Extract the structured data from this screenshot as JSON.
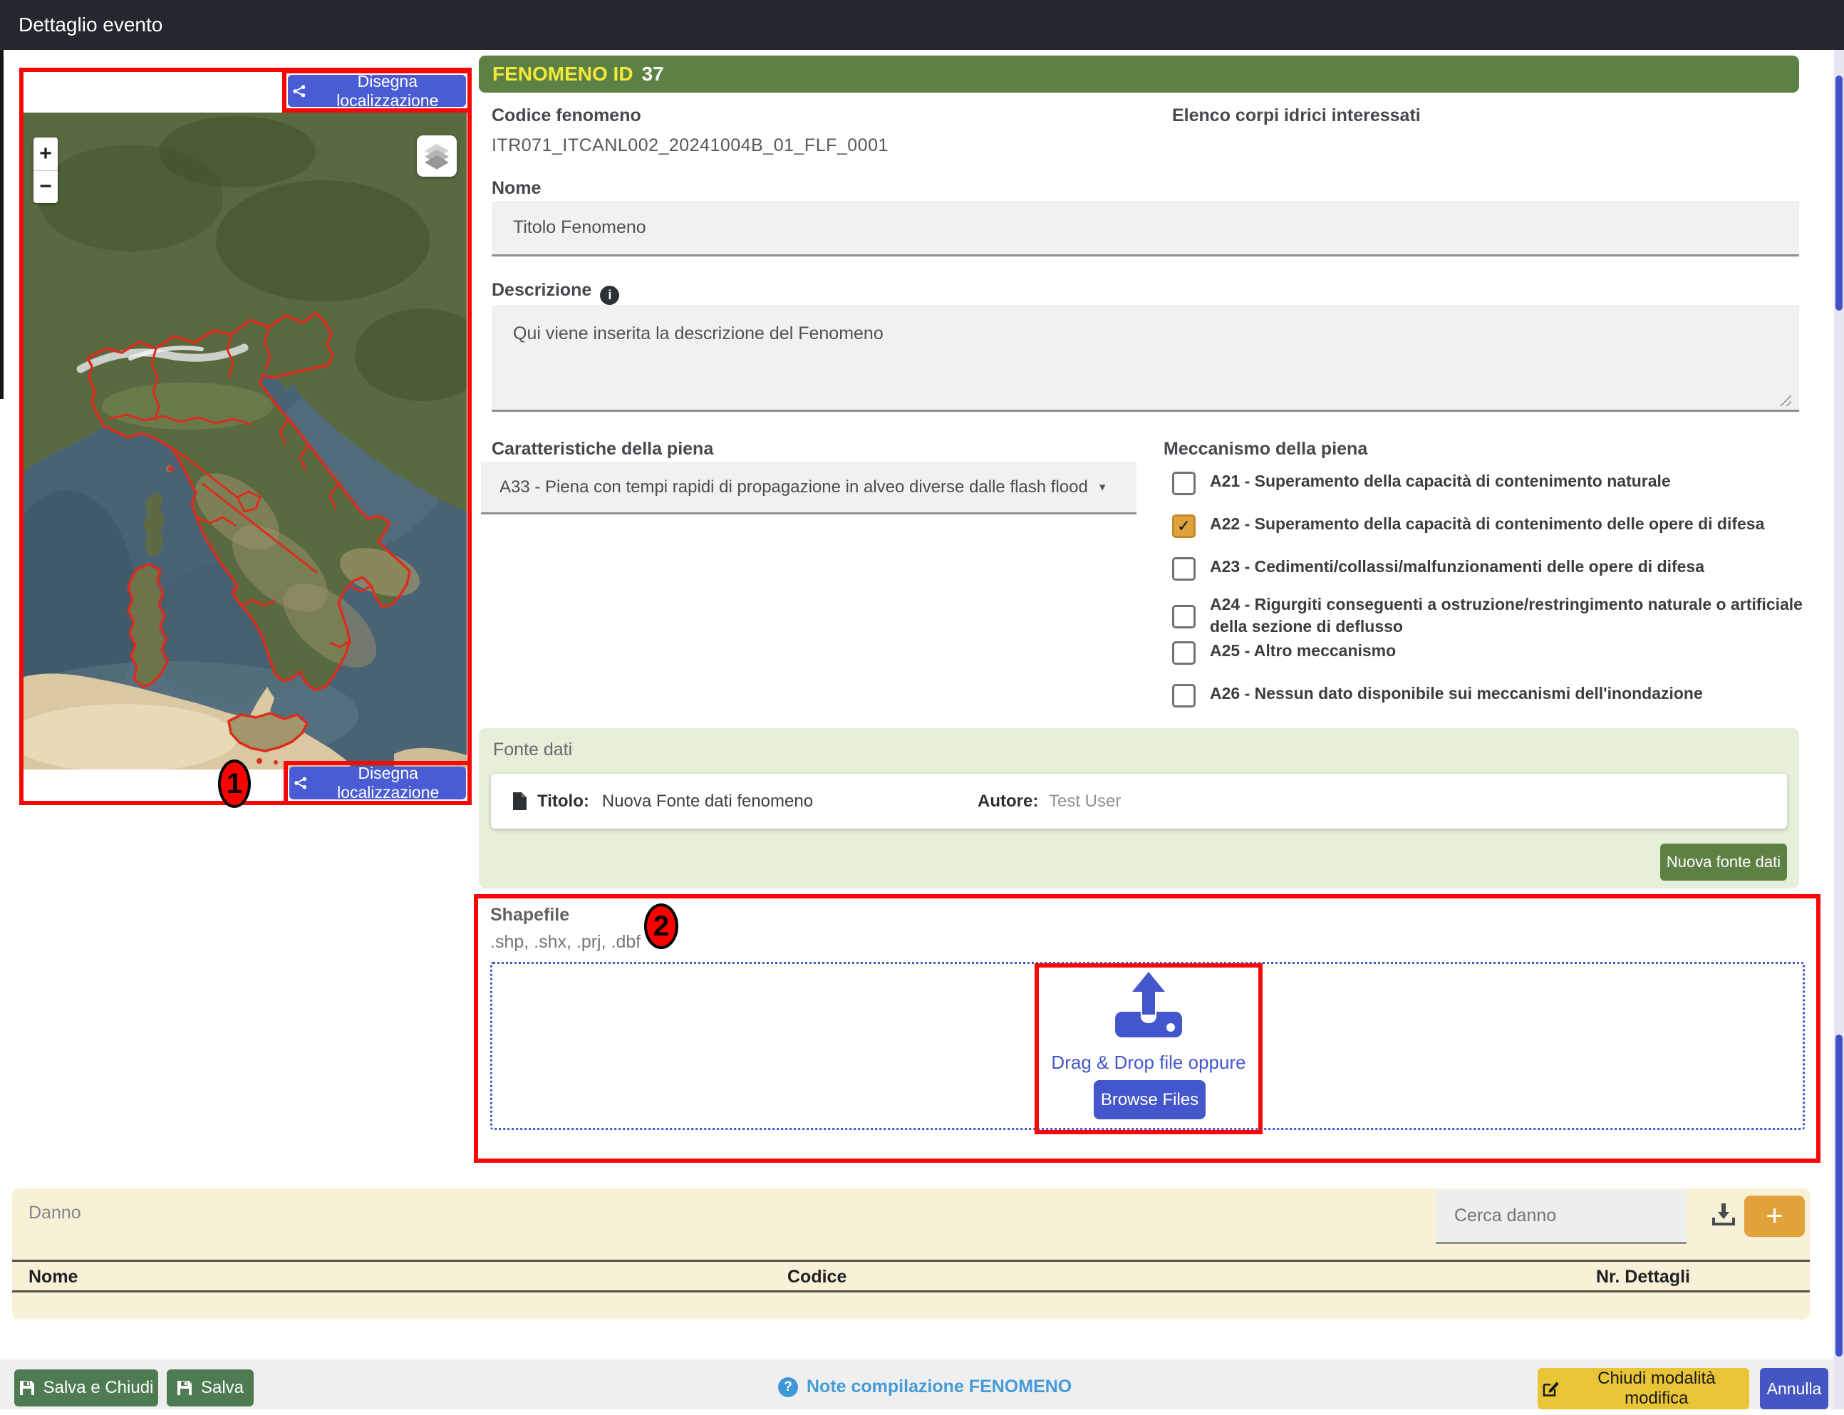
{
  "window": {
    "title": "Dettaglio evento"
  },
  "map": {
    "draw_button_top": "Disegna localizzazione",
    "draw_button_bottom": "Disegna localizzazione",
    "zoom_in": "+",
    "zoom_out": "−",
    "annotation_1": "1"
  },
  "fenomeno": {
    "header_label": "FENOMENO ID",
    "header_id": "37",
    "codice_label": "Codice fenomeno",
    "codice_value": "ITR071_ITCANL002_20241004B_01_FLF_0001",
    "elenco_label": "Elenco corpi idrici interessati",
    "nome_label": "Nome",
    "nome_value": "Titolo Fenomeno",
    "descrizione_label": "Descrizione",
    "descrizione_value": "Qui viene inserita la descrizione del Fenomeno",
    "caratteristiche_label": "Caratteristiche della piena",
    "caratteristiche_value": "A33 - Piena con tempi rapidi di propagazione in alveo diverse dalle flash flood",
    "meccanismo_label": "Meccanismo della piena",
    "meccanismo_items": [
      {
        "label": "A21 - Superamento della capacità di contenimento naturale",
        "checked": false
      },
      {
        "label": "A22 - Superamento della capacità di contenimento delle opere di difesa",
        "checked": true
      },
      {
        "label": "A23 - Cedimenti/collassi/malfunzionamenti delle opere di difesa",
        "checked": false
      },
      {
        "label": "A24 - Rigurgiti conseguenti a ostruzione/restringimento naturale o artificiale della sezione di deflusso",
        "checked": false
      },
      {
        "label": "A25 - Altro meccanismo",
        "checked": false
      },
      {
        "label": "A26 - Nessun dato disponibile sui meccanismi dell'inondazione",
        "checked": false
      }
    ]
  },
  "fonte_dati": {
    "section_label": "Fonte dati",
    "titolo_label": "Titolo:",
    "titolo_value": "Nuova Fonte dati fenomeno",
    "autore_label": "Autore:",
    "autore_value": "Test User",
    "new_button": "Nuova fonte dati"
  },
  "shapefile": {
    "label": "Shapefile",
    "extensions": ".shp, .shx, .prj, .dbf",
    "annotation_2": "2",
    "dropzone_text": "Drag & Drop file oppure",
    "browse_button": "Browse Files"
  },
  "danno": {
    "section_label": "Danno",
    "search_placeholder": "Cerca danno",
    "add_button": "+",
    "columns": [
      "Nome",
      "Codice",
      "Nr. Dettagli"
    ]
  },
  "footer": {
    "save_close": "Salva e Chiudi",
    "save": "Salva",
    "notes_link": "Note compilazione FENOMENO",
    "close_edit": "Chiudi modalità modifica",
    "cancel": "Annulla"
  },
  "colors": {
    "annotation_red": "#f70806",
    "primary_blue": "#4456cc",
    "header_green": "#5d8144",
    "save_green": "#4e7b52",
    "amber": "#e2a23b",
    "yellow": "#eac437",
    "checked_checkbox": "#e0a23c"
  }
}
